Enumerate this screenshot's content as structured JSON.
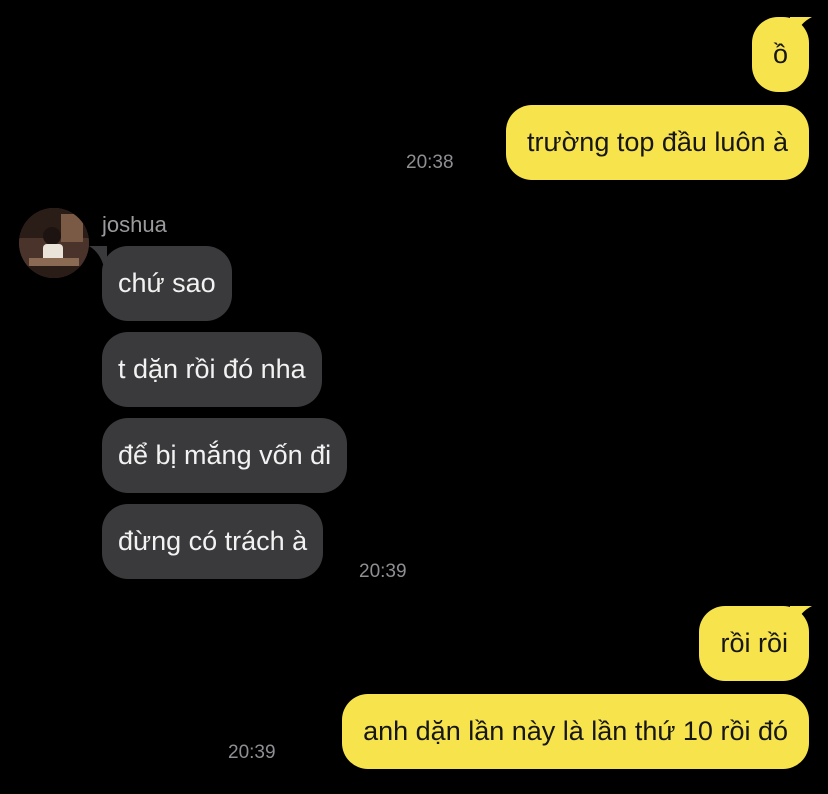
{
  "conversation": {
    "contact": {
      "name": "joshua",
      "avatar_icon": "profile-photo-avatar"
    },
    "messages": [
      {
        "text": "ồ",
        "direction": "outgoing"
      },
      {
        "text": "trường top đầu luôn à",
        "direction": "outgoing",
        "time": "20:38"
      },
      {
        "text": "chứ sao",
        "direction": "incoming"
      },
      {
        "text": "t dặn rồi đó nha",
        "direction": "incoming"
      },
      {
        "text": "để bị mắng vốn đi",
        "direction": "incoming"
      },
      {
        "text": "đừng có trách à",
        "direction": "incoming",
        "time": "20:39"
      },
      {
        "text": "rồi rồi",
        "direction": "outgoing"
      },
      {
        "text": "anh dặn lần này là lần thứ 10 rồi đó",
        "direction": "outgoing",
        "time": "20:39"
      }
    ]
  },
  "colors": {
    "background": "#000000",
    "outgoing_bubble": "#f7e34b",
    "incoming_bubble": "#3a3a3c",
    "timestamp": "#8e8e93"
  }
}
